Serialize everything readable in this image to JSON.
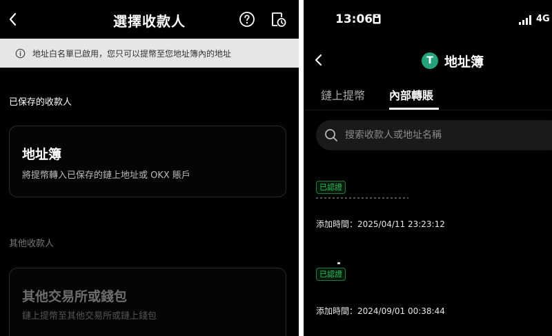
{
  "left": {
    "title": "選擇收款人",
    "notice": "地址白名單已啟用，您只可以提幣至您地址簿內的地址",
    "saved_section": "已保存的收款人",
    "address_book_card": {
      "title": "地址簿",
      "desc": "將提幣轉入已保存的鏈上地址或 OKX 賬戶"
    },
    "other_section": "其他收款人",
    "other_card": {
      "title": "其他交易所或錢包",
      "desc": "鏈上提幣至其他交易所或鏈上錢包"
    }
  },
  "right": {
    "status": {
      "time": "13:06",
      "network": "4G"
    },
    "title": "地址簿",
    "logo_letter": "T",
    "tabs": [
      "鏈上提幣",
      "內部轉賬"
    ],
    "active_tab": "內部轉賬",
    "search": {
      "placeholder": "搜索收款人或地址名稱"
    },
    "entries": [
      {
        "badge": "已認證",
        "added": "添加時間：2025/04/11 23:23:12"
      },
      {
        "badge": "已認證",
        "added": "添加時間：2024/09/01 00:38:44"
      }
    ]
  },
  "colors": {
    "background": "#000000",
    "notice_bg": "#e6e6e6",
    "verified_green": "#2fc35c",
    "usdt_green": "#26a17b",
    "search_bg": "#1a1a1a"
  },
  "icons": {
    "left_back": "chevron-left-icon",
    "help": "help-circle-icon",
    "history": "document-clock-icon",
    "notice": "info-icon",
    "right_back": "chevron-left-icon",
    "search": "search-icon",
    "signal": "signal-bars-icon",
    "status_badge": "sim-card-icon"
  }
}
